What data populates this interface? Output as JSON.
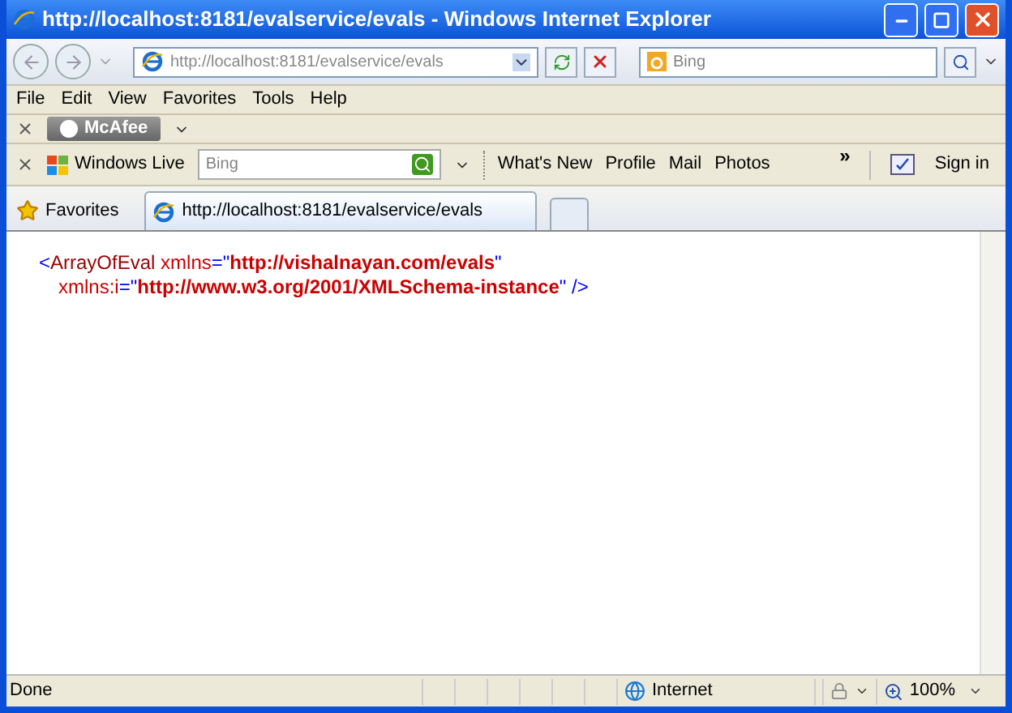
{
  "window": {
    "title": "http://localhost:8181/evalservice/evals - Windows Internet Explorer"
  },
  "address": {
    "value": "http://localhost:8181/evalservice/evals"
  },
  "search": {
    "placeholder": "Bing"
  },
  "menu": [
    "File",
    "Edit",
    "View",
    "Favorites",
    "Tools",
    "Help"
  ],
  "mcafee": {
    "label": "McAfee"
  },
  "live_toolbar": {
    "brand": "Windows Live",
    "search_placeholder": "Bing",
    "links": [
      "What's New",
      "Profile",
      "Mail",
      "Photos"
    ],
    "more": "»",
    "sign_in": "Sign in"
  },
  "favorites": {
    "label": "Favorites"
  },
  "tabs": [
    {
      "label": "http://localhost:8181/evalservice/evals",
      "selected": true
    }
  ],
  "document": {
    "lines": [
      [
        {
          "kind": "punct",
          "text": "<"
        },
        {
          "kind": "tag",
          "text": "ArrayOfEval"
        },
        {
          "kind": "attr",
          "text": " xmlns"
        },
        {
          "kind": "punct",
          "text": "=\""
        },
        {
          "kind": "value",
          "text": "http://vishalnayan.com/evals"
        },
        {
          "kind": "punct",
          "text": "\""
        }
      ],
      [
        {
          "kind": "attr",
          "text": "xmlns:i"
        },
        {
          "kind": "punct",
          "text": "=\""
        },
        {
          "kind": "value",
          "text": "http://www.w3.org/2001/XMLSchema-instance"
        },
        {
          "kind": "punct",
          "text": "\" />"
        }
      ]
    ]
  },
  "status_bar": {
    "text": "Done",
    "zone": "Internet",
    "zoom": "100%"
  }
}
